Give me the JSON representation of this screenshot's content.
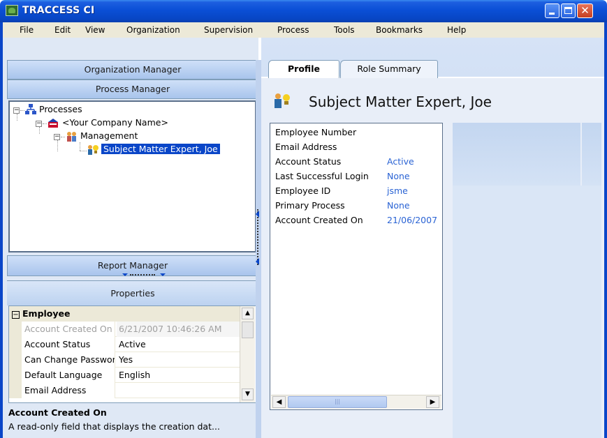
{
  "window": {
    "title": "TRACCESS CI",
    "icons": {
      "app": "app-tree-icon",
      "minimize": "minimize-icon",
      "maximize": "maximize-icon",
      "close": "close-icon"
    }
  },
  "menu": [
    "File",
    "Edit",
    "View",
    "Organization",
    "Supervision",
    "Process",
    "Tools",
    "Bookmarks",
    "Help"
  ],
  "left": {
    "organization_manager": "Organization Manager",
    "process_manager": "Process Manager",
    "report_manager": "Report Manager",
    "tree": {
      "root": "Processes",
      "company": "<Your Company Name>",
      "group": "Management",
      "selected": "Subject Matter Expert, Joe"
    },
    "properties": {
      "header": "Properties",
      "category": "Employee",
      "rows": [
        {
          "name": "Account Created On",
          "value": "6/21/2007 10:46:26 AM",
          "readonly": true
        },
        {
          "name": "Account Status",
          "value": "Active"
        },
        {
          "name": "Can Change Password",
          "value": "Yes"
        },
        {
          "name": "Default Language",
          "value": "English"
        },
        {
          "name": "Email Address",
          "value": ""
        }
      ],
      "description_title": "Account Created On",
      "description_text": "A read-only field that displays the creation dat..."
    }
  },
  "right": {
    "tabs": [
      "Profile",
      "Role Summary"
    ],
    "active_tab": "Profile",
    "title": "Subject Matter Expert, Joe",
    "fields": [
      {
        "label": "Employee Number",
        "value": ""
      },
      {
        "label": "Email Address",
        "value": ""
      },
      {
        "label": "Account Status",
        "value": "Active"
      },
      {
        "label": "Last Successful Login",
        "value": "None"
      },
      {
        "label": "Employee ID",
        "value": "jsme"
      },
      {
        "label": "Primary Process",
        "value": "None"
      },
      {
        "label": "Account Created On",
        "value": "21/06/2007"
      }
    ]
  },
  "colors": {
    "titlebar": "#0a4fd6",
    "menubar": "#ece9d8",
    "selection": "#0a46c8",
    "value_text": "#2a63d4",
    "panel_bg": "#c6d8f2"
  }
}
